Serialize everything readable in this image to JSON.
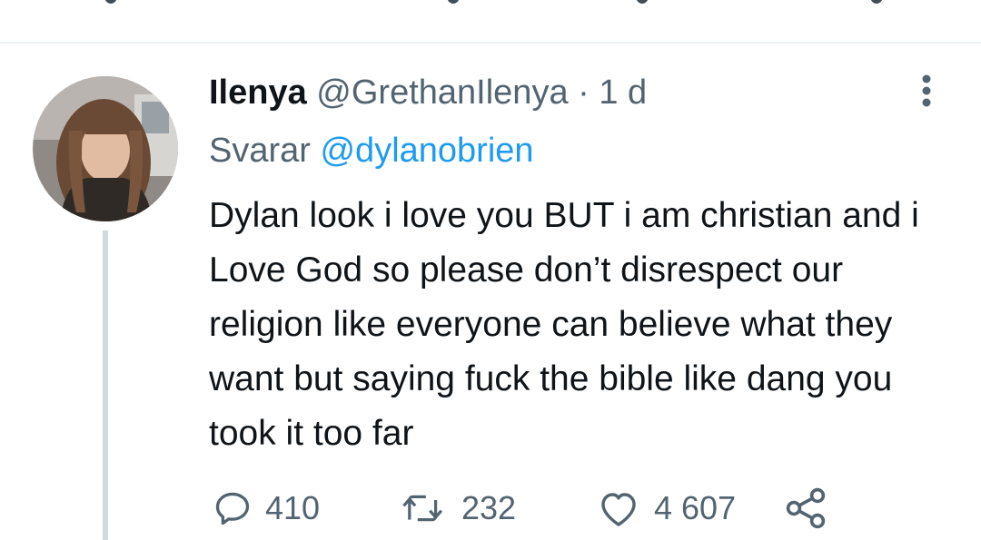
{
  "tweet": {
    "display_name": "Ilenya",
    "handle": "@GrethanIlenya",
    "separator": "·",
    "time": "1 d",
    "replying_prefix": "Svarar",
    "replying_to": "@dylanobrien",
    "text": "Dylan look i love you BUT i am christian and i Love God so please don’t disrespect our religion like everyone can believe what they want but saying fuck the bible like dang you took it too far"
  },
  "actions": {
    "reply_count": "410",
    "retweet_count": "232",
    "like_count": "4 607"
  },
  "icons": {
    "avatar": "avatar",
    "more": "more-vertical-icon",
    "reply": "reply-icon",
    "retweet": "retweet-icon",
    "like": "heart-icon",
    "share": "share-icon"
  },
  "colors": {
    "text": "#0f1419",
    "secondary": "#536471",
    "link": "#1d9bf0",
    "thread_line": "#cfd9de"
  }
}
